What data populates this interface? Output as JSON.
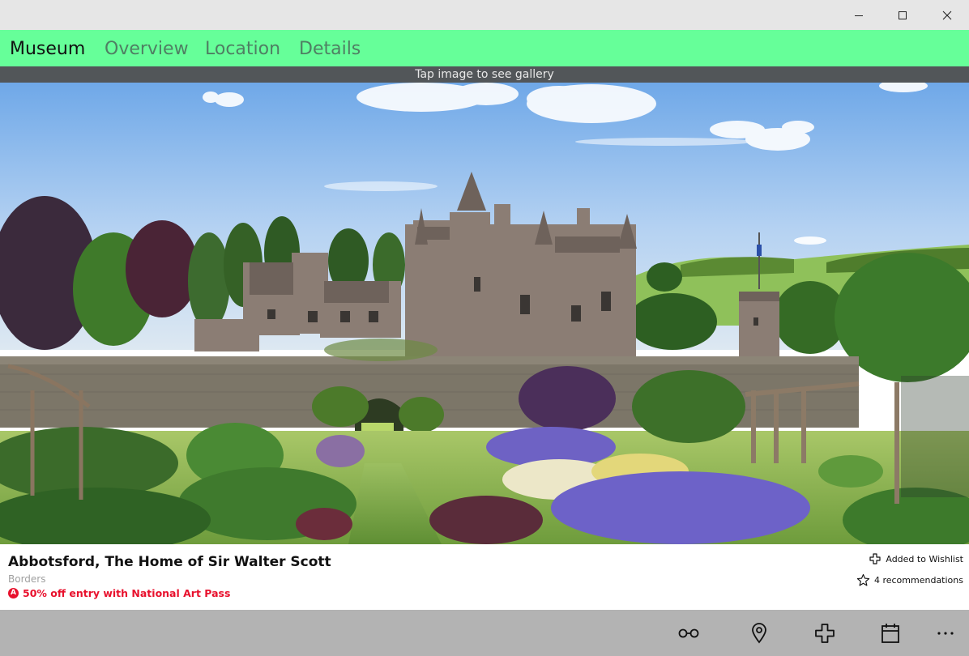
{
  "window": {
    "controls": [
      "minimize-icon",
      "maximize-icon",
      "close-icon"
    ]
  },
  "nav": {
    "tabs": [
      {
        "label": "Museum",
        "active": true
      },
      {
        "label": "Overview",
        "active": false
      },
      {
        "label": "Location",
        "active": false
      },
      {
        "label": "Details",
        "active": false
      }
    ]
  },
  "gallery": {
    "hint": "Tap image to see gallery"
  },
  "museum": {
    "title": "Abbotsford, The Home of Sir Walter Scott",
    "region": "Borders",
    "offer": "50% off entry with National Art Pass",
    "offer_badge": "A",
    "wishlist_label": "Added to Wishlist",
    "recommendations_label": "4 recommendations"
  },
  "appbar": {
    "icons": [
      "glasses-icon",
      "map-pin-icon",
      "add-cross-icon",
      "calendar-icon",
      "more-icon"
    ]
  },
  "colors": {
    "nav_background": "#66ff99",
    "offer_red": "#e8112d",
    "appbar_background": "#b3b3b3",
    "gallery_hint_background": "#525659"
  }
}
